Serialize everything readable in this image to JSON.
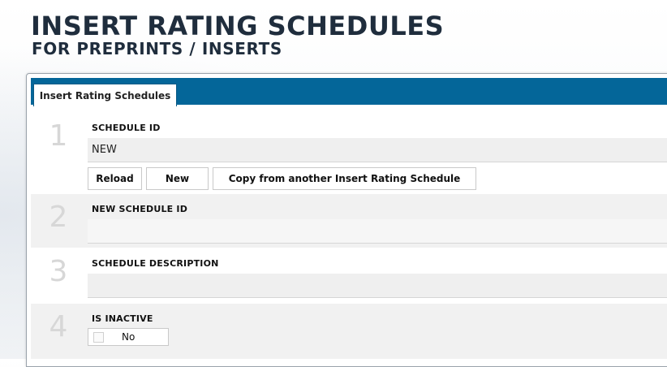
{
  "header": {
    "title": "INSERT RATING SCHEDULES",
    "subtitle": "FOR PREPRINTS / INSERTS"
  },
  "tabs": [
    {
      "label": "Insert Rating Schedules",
      "active": true
    }
  ],
  "colors": {
    "tab_bar": "#046699",
    "row_alt": "#f1f1f1",
    "step_number": "#d7d7d7",
    "heading": "#1f2d3d"
  },
  "form": {
    "rows": [
      {
        "number": "1",
        "label": "SCHEDULE ID",
        "value": "NEW"
      },
      {
        "number": "2",
        "label": "NEW SCHEDULE ID",
        "value": ""
      },
      {
        "number": "3",
        "label": "SCHEDULE DESCRIPTION",
        "value": ""
      },
      {
        "number": "4",
        "label": "IS INACTIVE",
        "value": "No",
        "checked": false
      }
    ],
    "buttons": {
      "reload": "Reload",
      "new": "New",
      "copy": "Copy from another Insert Rating Schedule"
    }
  }
}
